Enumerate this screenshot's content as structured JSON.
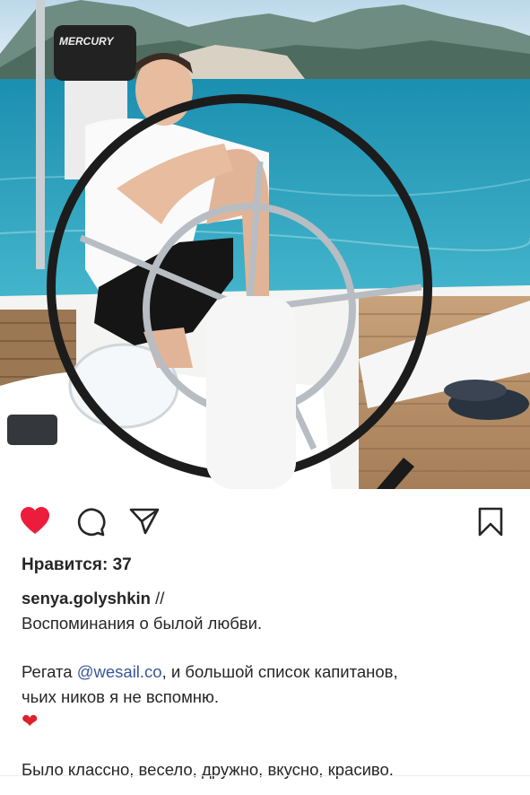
{
  "post": {
    "photo_alt": "",
    "outboard_brand": "MERCURY",
    "likes_label": "Нравится: 37",
    "username": "senya.golyshkin",
    "username_suffix": " //",
    "line1": "Воспоминания о былой любви.",
    "line2_prefix": "Регата ",
    "mention": "@wesail.co",
    "line2_suffix": ", и большой список капитанов,",
    "line3": "чьих ников я не вспомню.",
    "emoji": "❤",
    "line4": "Было классно, весело, дружно, вкусно, красиво."
  },
  "actions": {
    "like_icon": "heart-filled-icon",
    "comment_icon": "comment-icon",
    "share_icon": "send-icon",
    "save_icon": "bookmark-icon"
  },
  "colors": {
    "like": "#ed1c3c",
    "mention": "#385898",
    "text": "#262626"
  }
}
